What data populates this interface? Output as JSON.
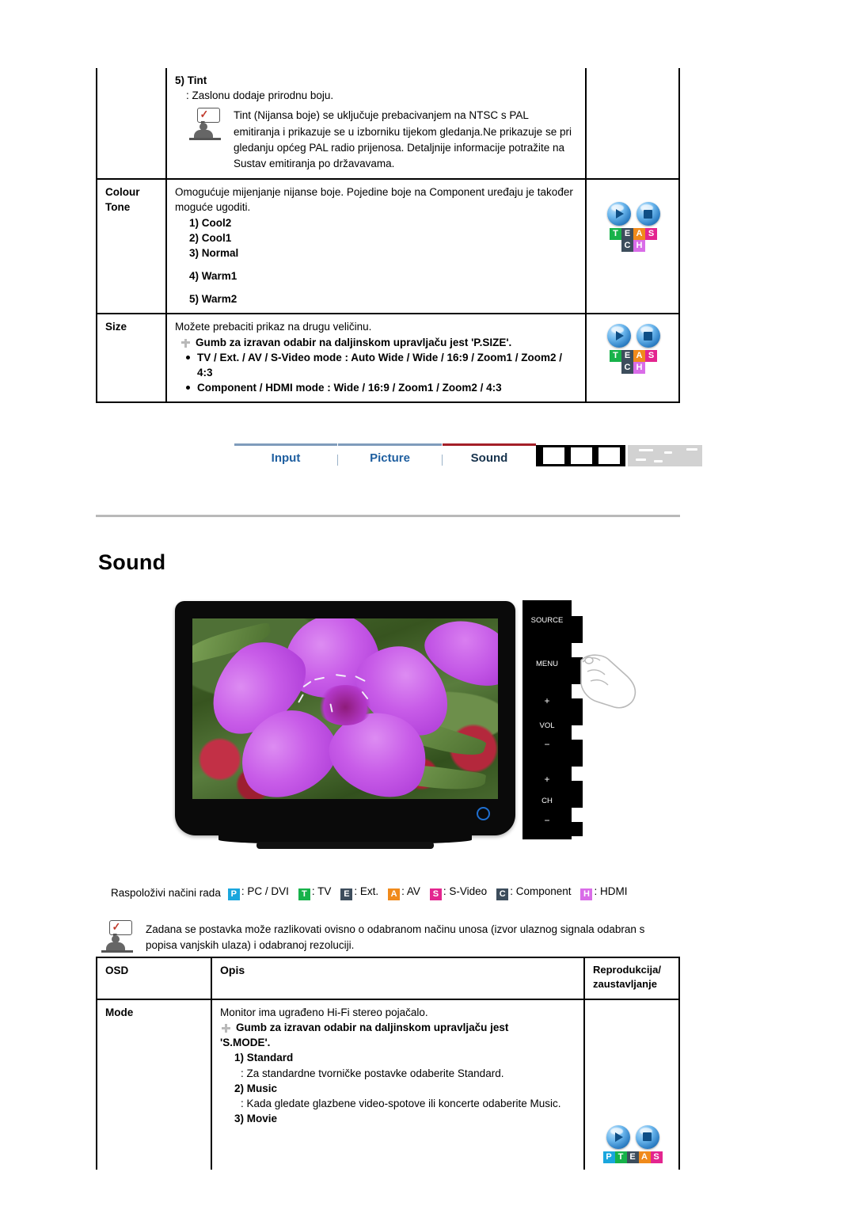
{
  "document": {
    "heading": "Sound"
  },
  "top_table": {
    "rows": [
      {
        "osd": "",
        "tint": {
          "title": "5) Tint",
          "desc": ": Zaslonu dodaje prirodnu boju.",
          "note": "Tint (Nijansa boje) se uključuje prebacivanjem na NTSC s PAL emitiranja i prikazuje se u izborniku tijekom gledanja.Ne prikazuje se pri gledanju općeg PAL radio prijenosa. Detaljnije informacije potražite na Sustav emitiranja po državavama."
        }
      },
      {
        "osd": "Colour Tone",
        "osd_line1": "Colour",
        "osd_line2": "Tone",
        "desc": "Omogućuje mijenjanje nijanse boje. Pojedine boje na Component uređaju je također moguće ugoditi.",
        "options": [
          "1) Cool2",
          "2) Cool1",
          "3) Normal",
          "4) Warm1",
          "5) Warm2"
        ],
        "play_icons": [
          "play-icon",
          "stop-icon"
        ],
        "mode_tiles_row1": [
          "T",
          "E",
          "A",
          "S"
        ],
        "mode_tiles_row2": [
          "C",
          "H"
        ]
      },
      {
        "osd": "Size",
        "desc": "Možete prebaciti prikaz na drugu veličinu.",
        "remote_hint": "Gumb za izravan odabir na daljinskom upravljaču jest 'P.SIZE'.",
        "bullets": [
          "TV / Ext. / AV / S-Video mode : Auto Wide / Wide / 16:9 / Zoom1 / Zoom2 / 4:3",
          "Component / HDMI mode : Wide / 16:9 / Zoom1 / Zoom2 / 4:3"
        ],
        "play_icons": [
          "play-icon",
          "stop-icon"
        ],
        "mode_tiles_row1": [
          "T",
          "E",
          "A",
          "S"
        ],
        "mode_tiles_row2": [
          "C",
          "H"
        ]
      }
    ]
  },
  "nav": {
    "tabs": [
      {
        "label": "Input",
        "active": false
      },
      {
        "label": "Picture",
        "active": false
      },
      {
        "label": "Sound",
        "active": true
      }
    ]
  },
  "figure": {
    "panel_buttons": [
      "SOURCE",
      "MENU",
      "+",
      "VOL",
      "−",
      "+",
      "CH",
      "−"
    ],
    "alt": "monitor displaying purple flower photo with side control panel and hand pointer"
  },
  "legend": {
    "intro": "Raspoloživi načini rada",
    "items": [
      {
        "badge": "P",
        "color": "#1aa6dd",
        "text": ": PC / DVI"
      },
      {
        "badge": "T",
        "color": "#17b24a",
        "text": ": TV"
      },
      {
        "badge": "E",
        "color": "#3d4d5c",
        "text": ": Ext."
      },
      {
        "badge": "A",
        "color": "#f08a1b",
        "text": ": AV"
      },
      {
        "badge": "S",
        "color": "#e3258f",
        "text": ": S-Video"
      },
      {
        "badge": "C",
        "color": "#3d4d5c",
        "text": ": Component"
      },
      {
        "badge": "H",
        "color": "#d96ce8",
        "text": ": HDMI"
      }
    ]
  },
  "note": {
    "text": "Zadana se postavka može razlikovati ovisno o odabranom načinu unosa (izvor ulaznog signala odabran s popisa vanjskih ulaza) i odabranoj rezoluciji."
  },
  "bottom_table": {
    "headers": {
      "osd": "OSD",
      "opis": "Opis",
      "play_line1": "Reprodukcija/",
      "play_line2": "zaustavljanje"
    },
    "rows": [
      {
        "osd": "Mode",
        "desc": "Monitor ima ugrađeno Hi-Fi stereo pojačalo.",
        "remote_hint_line1": "Gumb za izravan odabir na daljinskom upravljaču jest",
        "remote_hint_line2": "'S.MODE'.",
        "options": [
          {
            "title": "1) Standard",
            "desc": ": Za standardne tvorničke postavke odaberite Standard."
          },
          {
            "title": "2) Music",
            "desc": ": Kada gledate glazbene video-spotove ili koncerte odaberite Music."
          },
          {
            "title": "3) Movie",
            "desc": ""
          }
        ],
        "play_icons": [
          "play-icon",
          "stop-icon"
        ],
        "mode_tiles_row1": [
          "P",
          "T",
          "E",
          "A",
          "S"
        ]
      }
    ]
  },
  "tile_colors": {
    "P": "#1aa6dd",
    "T": "#17b24a",
    "E": "#3d4d5c",
    "A": "#f08a1b",
    "S": "#e3258f",
    "C": "#3d4d5c",
    "H": "#d96ce8"
  }
}
